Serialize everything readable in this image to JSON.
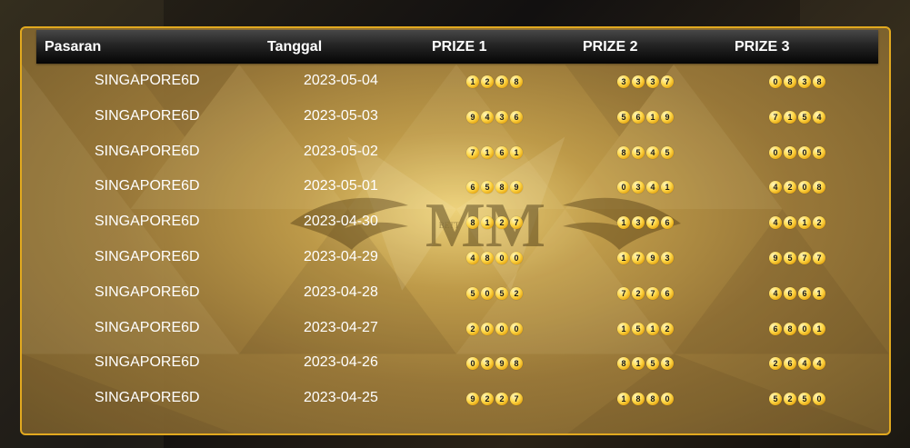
{
  "table": {
    "headers": {
      "pasaran": "Pasaran",
      "tanggal": "Tanggal",
      "prize1": "PRIZE 1",
      "prize2": "PRIZE 2",
      "prize3": "PRIZE 3"
    },
    "rows": [
      {
        "pasaran": "SINGAPORE6D",
        "tanggal": "2023-05-04",
        "p1": [
          "1",
          "2",
          "9",
          "8"
        ],
        "p2": [
          "3",
          "3",
          "3",
          "7"
        ],
        "p3": [
          "0",
          "8",
          "3",
          "8"
        ]
      },
      {
        "pasaran": "SINGAPORE6D",
        "tanggal": "2023-05-03",
        "p1": [
          "9",
          "4",
          "3",
          "6"
        ],
        "p2": [
          "5",
          "6",
          "1",
          "9"
        ],
        "p3": [
          "7",
          "1",
          "5",
          "4"
        ]
      },
      {
        "pasaran": "SINGAPORE6D",
        "tanggal": "2023-05-02",
        "p1": [
          "7",
          "1",
          "6",
          "1"
        ],
        "p2": [
          "8",
          "5",
          "4",
          "5"
        ],
        "p3": [
          "0",
          "9",
          "0",
          "5"
        ]
      },
      {
        "pasaran": "SINGAPORE6D",
        "tanggal": "2023-05-01",
        "p1": [
          "6",
          "5",
          "8",
          "9"
        ],
        "p2": [
          "0",
          "3",
          "4",
          "1"
        ],
        "p3": [
          "4",
          "2",
          "0",
          "8"
        ]
      },
      {
        "pasaran": "SINGAPORE6D",
        "tanggal": "2023-04-30",
        "p1": [
          "8",
          "1",
          "2",
          "7"
        ],
        "p2": [
          "1",
          "3",
          "7",
          "6"
        ],
        "p3": [
          "4",
          "6",
          "1",
          "2"
        ]
      },
      {
        "pasaran": "SINGAPORE6D",
        "tanggal": "2023-04-29",
        "p1": [
          "4",
          "8",
          "0",
          "0"
        ],
        "p2": [
          "1",
          "7",
          "9",
          "3"
        ],
        "p3": [
          "9",
          "5",
          "7",
          "7"
        ]
      },
      {
        "pasaran": "SINGAPORE6D",
        "tanggal": "2023-04-28",
        "p1": [
          "5",
          "0",
          "5",
          "2"
        ],
        "p2": [
          "7",
          "2",
          "7",
          "6"
        ],
        "p3": [
          "4",
          "6",
          "6",
          "1"
        ]
      },
      {
        "pasaran": "SINGAPORE6D",
        "tanggal": "2023-04-27",
        "p1": [
          "2",
          "0",
          "0",
          "0"
        ],
        "p2": [
          "1",
          "5",
          "1",
          "2"
        ],
        "p3": [
          "6",
          "8",
          "0",
          "1"
        ]
      },
      {
        "pasaran": "SINGAPORE6D",
        "tanggal": "2023-04-26",
        "p1": [
          "0",
          "3",
          "9",
          "8"
        ],
        "p2": [
          "8",
          "1",
          "5",
          "3"
        ],
        "p3": [
          "2",
          "6",
          "4",
          "4"
        ]
      },
      {
        "pasaran": "SINGAPORE6D",
        "tanggal": "2023-04-25",
        "p1": [
          "9",
          "2",
          "2",
          "7"
        ],
        "p2": [
          "1",
          "8",
          "8",
          "0"
        ],
        "p3": [
          "5",
          "2",
          "5",
          "0"
        ]
      }
    ]
  },
  "watermark": {
    "logo_text": "MM",
    "logo_small": "BETT"
  },
  "colors": {
    "panel_border": "#e2a91f",
    "ball": "#ffd84a",
    "header_bg": "#1e1e1e",
    "text": "#ffffff"
  }
}
